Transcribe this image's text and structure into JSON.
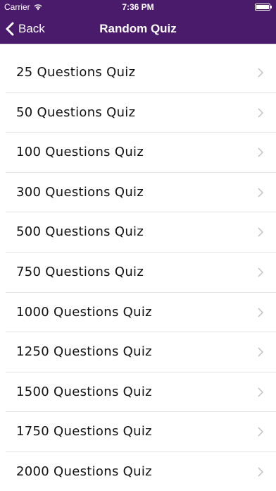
{
  "status_bar": {
    "carrier": "Carrier",
    "time": "7:36 PM"
  },
  "nav": {
    "back_label": "Back",
    "title": "Random Quiz"
  },
  "quiz_list": [
    {
      "label": "25 Questions Quiz"
    },
    {
      "label": "50 Questions Quiz"
    },
    {
      "label": "100 Questions Quiz"
    },
    {
      "label": "300 Questions Quiz"
    },
    {
      "label": "500 Questions Quiz"
    },
    {
      "label": "750 Questions Quiz"
    },
    {
      "label": "1000 Questions Quiz"
    },
    {
      "label": "1250 Questions Quiz"
    },
    {
      "label": "1500 Questions Quiz"
    },
    {
      "label": "1750 Questions Quiz"
    },
    {
      "label": "2000 Questions Quiz"
    }
  ],
  "colors": {
    "nav_background": "#4a1a6b",
    "nav_text": "#ffffff",
    "separator": "#e3e3e3",
    "chevron": "#c7c7cc"
  }
}
